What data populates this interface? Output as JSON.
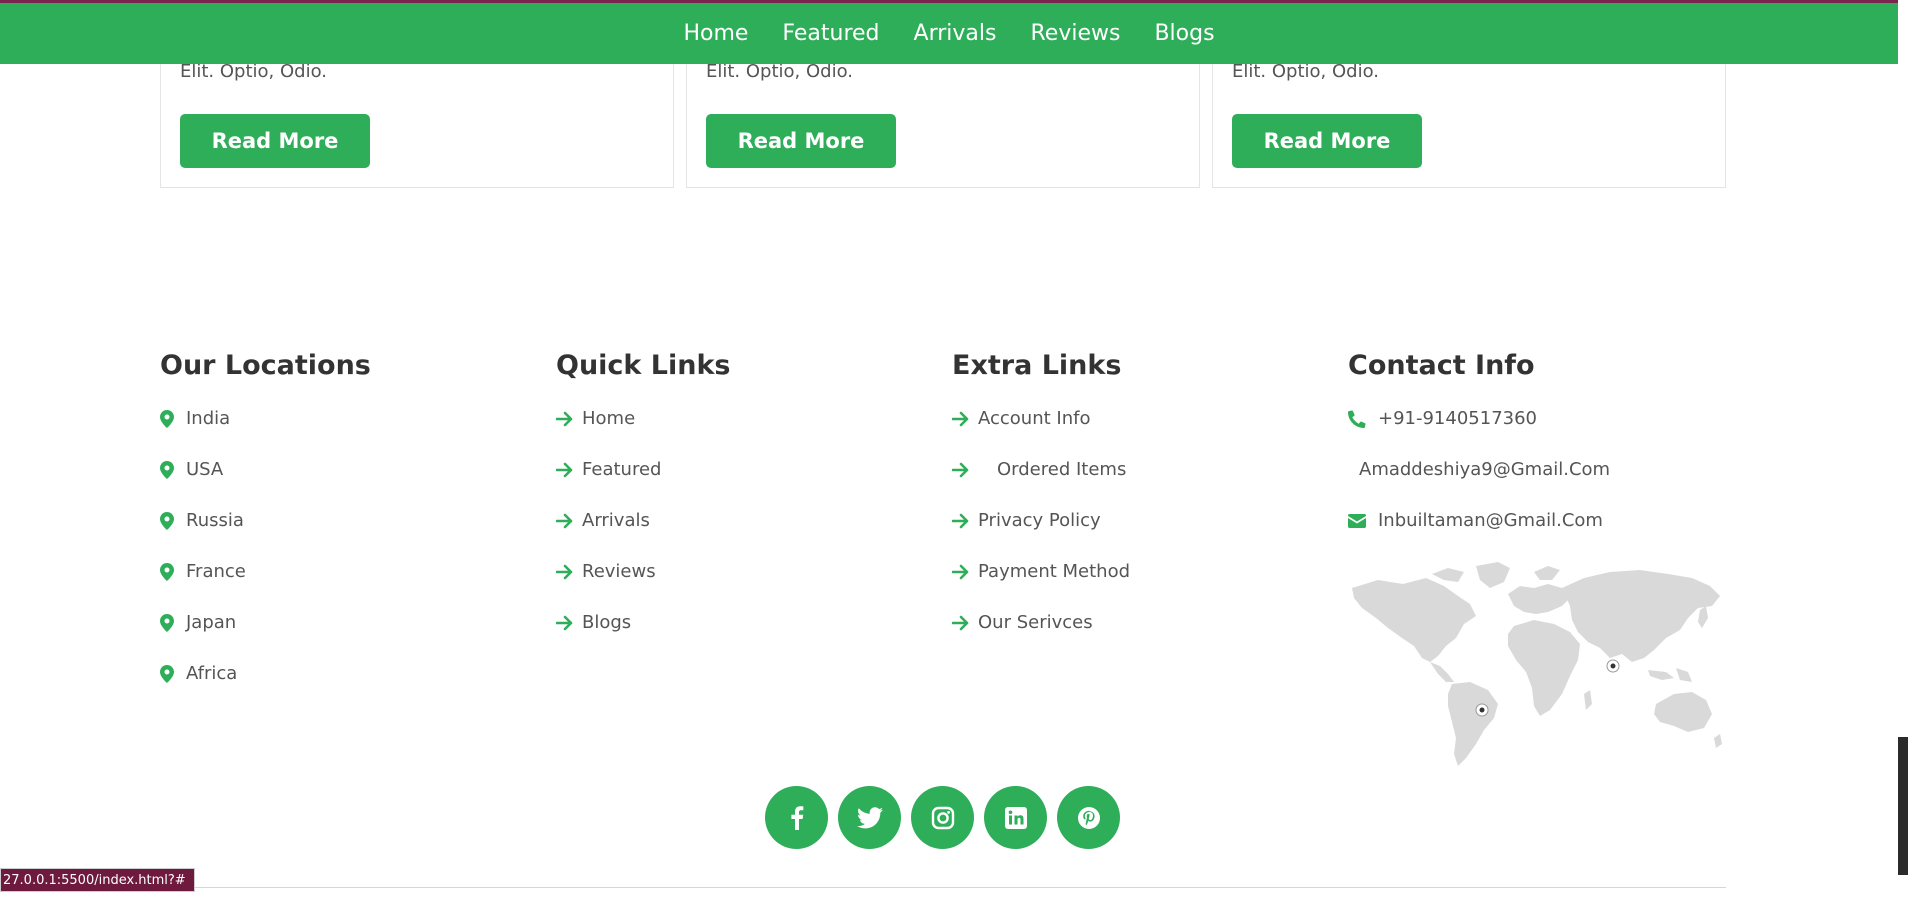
{
  "nav": {
    "links": [
      "Home",
      "Featured",
      "Arrivals",
      "Reviews",
      "Blogs"
    ]
  },
  "cards": [
    {
      "excerpt": "Elit. Optio, Odio.",
      "button": "Read More"
    },
    {
      "excerpt": "Elit. Optio, Odio.",
      "button": "Read More"
    },
    {
      "excerpt": "Elit. Optio, Odio.",
      "button": "Read More"
    }
  ],
  "footer": {
    "locations": {
      "title": "Our Locations",
      "items": [
        "India",
        "USA",
        "Russia",
        "France",
        "Japan",
        "Africa"
      ]
    },
    "quick_links": {
      "title": "Quick Links",
      "items": [
        "Home",
        "Featured",
        "Arrivals",
        "Reviews",
        "Blogs"
      ]
    },
    "extra_links": {
      "title": "Extra Links",
      "items": [
        "Account Info",
        "Ordered Items",
        "Privacy Policy",
        "Payment Method",
        "Our Serivces"
      ]
    },
    "contact": {
      "title": "Contact Info",
      "phone": "+91-9140517360",
      "email1": "Amaddeshiya9@Gmail.Com",
      "email2": "Inbuiltaman@Gmail.Com"
    }
  },
  "socials": [
    "facebook-icon",
    "twitter-icon",
    "instagram-icon",
    "linkedin-icon",
    "pinterest-icon"
  ],
  "status_url": "27.0.0.1:5500/index.html?#",
  "colors": {
    "accent": "#2fae5a",
    "heading": "#333333",
    "text": "#555555"
  }
}
